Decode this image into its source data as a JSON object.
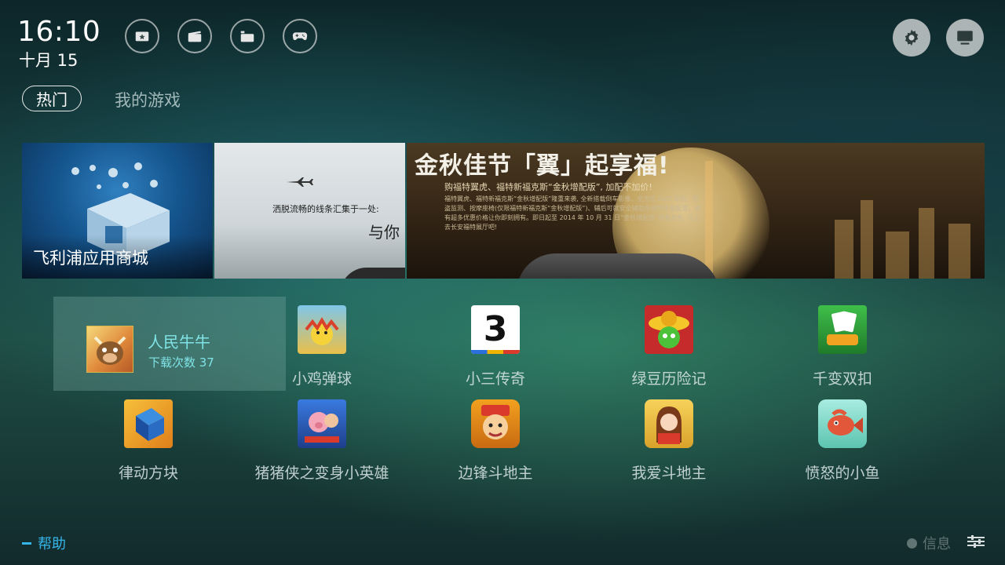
{
  "status": {
    "time": "16:10",
    "date": "十月 15"
  },
  "top_icons": [
    "favorites-icon",
    "video-icon",
    "media-icon",
    "gamepad-icon"
  ],
  "right_icons": [
    "settings-icon",
    "display-icon"
  ],
  "tabs": [
    {
      "label": "热门",
      "active": true
    },
    {
      "label": "我的游戏",
      "active": false
    }
  ],
  "banners": {
    "store": {
      "label": "飞利浦应用商城"
    },
    "car": {
      "line1": "洒脱流畅的线条汇集于一处:",
      "line2": "与你"
    },
    "festival": {
      "title": "金秋佳节「翼」起享福!",
      "subtitle": "购福特翼虎、福特新福克斯“金秋增配版”, 加配不加价!",
      "body": "福特翼虎、福特新福克斯“金秋增配版”隆重来袭, 全新搭载倒车影像、全方位 DVD 导航、防盗监测、按摩座椅(仅限福特新福克斯“金秋增配版”)、辅后可就安全辅助系统等丰富配置。更有超多优惠价格让你即刻拥有。即日起至 2014 年 10 月 31 日“金秋增配版”限量发售, 马上去长安福特展厅吧!"
    }
  },
  "featured": {
    "name": "人民牛牛",
    "downloads": "下载次数 37"
  },
  "apps": [
    {
      "name": "小鸡弹球",
      "color": "#e9c04a"
    },
    {
      "name": "小三传奇",
      "color": "#ffffff"
    },
    {
      "name": "绿豆历险记",
      "color": "#c62b2b"
    },
    {
      "name": "千变双扣",
      "color": "#2f9a3a"
    },
    {
      "name": "律动方块",
      "color": "#f0a320"
    },
    {
      "name": "猪猪侠之变身小英雄",
      "color": "#2f5db8"
    },
    {
      "name": "边锋斗地主",
      "color": "#f3a11f"
    },
    {
      "name": "我爱斗地主",
      "color": "#f0c540"
    },
    {
      "name": "愤怒的小鱼",
      "color": "#7fd9c6"
    }
  ],
  "app_glyphs": {
    "xiaosan": "3"
  },
  "bottom": {
    "help": "帮助",
    "info": "信息"
  }
}
